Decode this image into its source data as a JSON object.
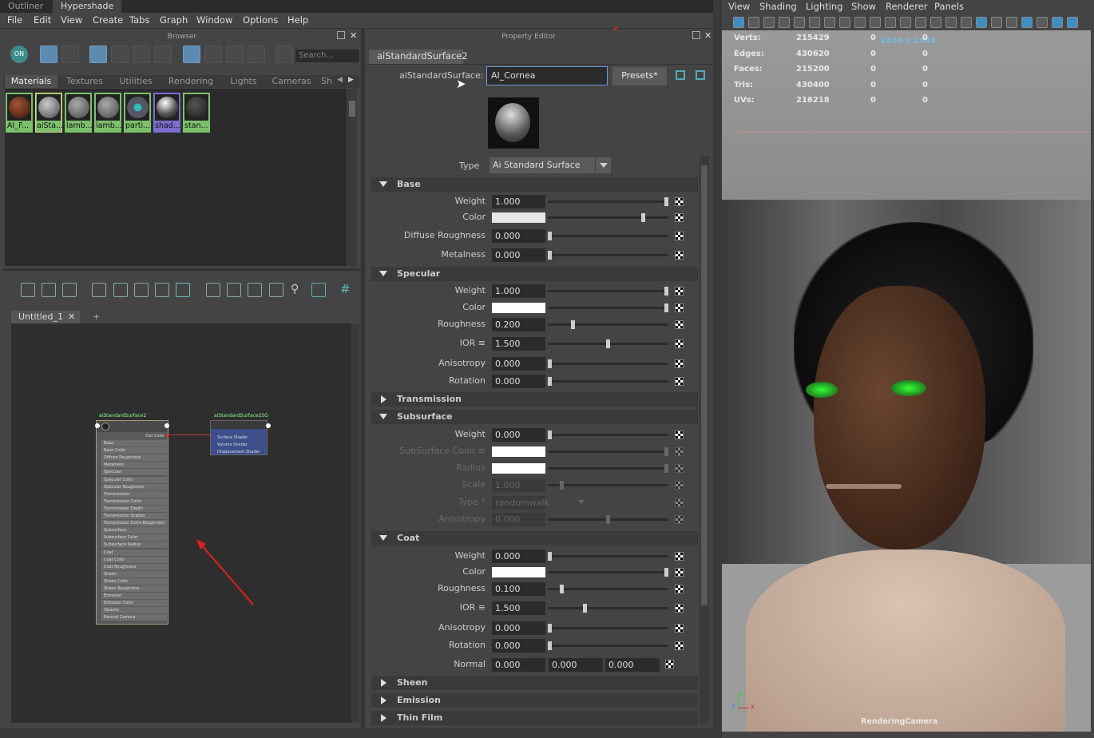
{
  "window_tabs": [
    "Outliner",
    "Hypershade"
  ],
  "menus": [
    "File",
    "Edit",
    "View",
    "Create",
    "Tabs",
    "Graph",
    "Window",
    "Options",
    "Help"
  ],
  "browser": {
    "title": "Browser",
    "search_placeholder": "Search...",
    "tabs": [
      "Materials",
      "Textures",
      "Utilities",
      "Rendering",
      "Lights",
      "Cameras",
      "Sh"
    ],
    "swatches": [
      {
        "label": "AI_F...",
        "color": "#6a3322"
      },
      {
        "label": "aiSta...",
        "color": "#888"
      },
      {
        "label": "lamb...",
        "color": "#777"
      },
      {
        "label": "lamb...",
        "color": "#777"
      },
      {
        "label": "parti...",
        "color": "#4a7a8a"
      },
      {
        "label": "shad...",
        "color": "#999"
      },
      {
        "label": "stan...",
        "color": "#333"
      }
    ],
    "toggle_label": "ON"
  },
  "graph": {
    "tab_label": "Untitled_1",
    "add_tab": "+",
    "node1": {
      "title": "aiStandardSurface2",
      "out": "Out Color",
      "attrs": [
        "Base",
        "Base Color",
        "Diffuse Roughness",
        "Metalness",
        "Specular",
        "Specular Color",
        "Specular Roughness",
        "Transmission",
        "Transmission Color",
        "Transmission Depth",
        "Transmission Scatter",
        "Transmission Extra Roughness",
        "Subsurface",
        "Subsurface Color",
        "Subsurface Radius",
        "Coat",
        "Coat Color",
        "Coat Roughness",
        "Sheen",
        "Sheen Color",
        "Sheen Roughness",
        "Emission",
        "Emission Color",
        "Opacity",
        "Normal Camera"
      ]
    },
    "node2": {
      "title": "aiStandardSurface2SG",
      "attrs": [
        "Surface Shader",
        "Volume Shader",
        "Displacement Shader"
      ]
    }
  },
  "property_editor": {
    "title": "Property Editor",
    "tab": "aiStandardSurface2",
    "name_label": "aiStandardSurface:",
    "name_value": "AI_Cornea",
    "presets": "Presets*",
    "type_label": "Type",
    "type_value": "Ai Standard Surface",
    "sections": {
      "base": {
        "title": "Base",
        "rows": [
          {
            "label": "Weight",
            "value": "1.000",
            "slider": 1.0
          },
          {
            "label": "Color",
            "color": "#e6e6e6",
            "slider": 0.8
          },
          {
            "label": "Diffuse Roughness",
            "value": "0.000",
            "slider": 0
          },
          {
            "label": "Metalness",
            "value": "0.000",
            "slider": 0
          }
        ]
      },
      "specular": {
        "title": "Specular",
        "rows": [
          {
            "label": "Weight",
            "value": "1.000",
            "slider": 1.0
          },
          {
            "label": "Color",
            "color": "#ffffff",
            "slider": 1.0
          },
          {
            "label": "Roughness",
            "value": "0.200",
            "slider": 0.2
          },
          {
            "label": "IOR ≡",
            "value": "1.500",
            "slider": 0.5
          },
          {
            "label": "Anisotropy",
            "value": "0.000",
            "slider": 0
          },
          {
            "label": "Rotation",
            "value": "0.000",
            "slider": 0
          }
        ]
      },
      "transmission": {
        "title": "Transmission"
      },
      "subsurface": {
        "title": "Subsurface",
        "rows": [
          {
            "label": "Weight",
            "value": "0.000",
            "slider": 0
          },
          {
            "label": "SubSurface Color ≡",
            "color": "#ffffff",
            "slider": 1.0,
            "dim": true
          },
          {
            "label": "Radius",
            "color": "#ffffff",
            "slider": 1.0,
            "dim": true
          },
          {
            "label": "Scale",
            "value": "1.000",
            "slider": 0.1,
            "dim": true
          },
          {
            "label": "Type *",
            "value": "randomwalk",
            "dim": true
          },
          {
            "label": "Anisotropy",
            "value": "0.000",
            "slider": 0.5,
            "dim": true
          }
        ]
      },
      "coat": {
        "title": "Coat",
        "rows": [
          {
            "label": "Weight",
            "value": "0.000",
            "slider": 0
          },
          {
            "label": "Color",
            "color": "#ffffff",
            "slider": 1.0
          },
          {
            "label": "Roughness",
            "value": "0.100",
            "slider": 0.1
          },
          {
            "label": "IOR ≡",
            "value": "1.500",
            "slider": 0.3
          },
          {
            "label": "Anisotropy",
            "value": "0.000",
            "slider": 0
          },
          {
            "label": "Rotation",
            "value": "0.000",
            "slider": 0
          }
        ],
        "normal": {
          "label": "Normal",
          "x": "0.000",
          "y": "0.000",
          "z": "0.000"
        }
      },
      "sheen": {
        "title": "Sheen"
      },
      "emission": {
        "title": "Emission"
      },
      "thinfilm": {
        "title": "Thin Film"
      }
    }
  },
  "viewport": {
    "menus": [
      "View",
      "Shading",
      "Lighting",
      "Show",
      "Renderer",
      "Panels"
    ],
    "resolution": "2048 x 2048",
    "stats": [
      {
        "label": "Verts:",
        "a": "215429",
        "b": "0",
        "c": "0"
      },
      {
        "label": "Edges:",
        "a": "430620",
        "b": "0",
        "c": "0"
      },
      {
        "label": "Faces:",
        "a": "215200",
        "b": "0",
        "c": "0"
      },
      {
        "label": "Tris:",
        "a": "430400",
        "b": "0",
        "c": "0"
      },
      {
        "label": "UVs:",
        "a": "216218",
        "b": "0",
        "c": "0"
      }
    ],
    "camera": "RenderingCamera",
    "axis": {
      "y": "y",
      "z": "z",
      "x": "x"
    }
  }
}
